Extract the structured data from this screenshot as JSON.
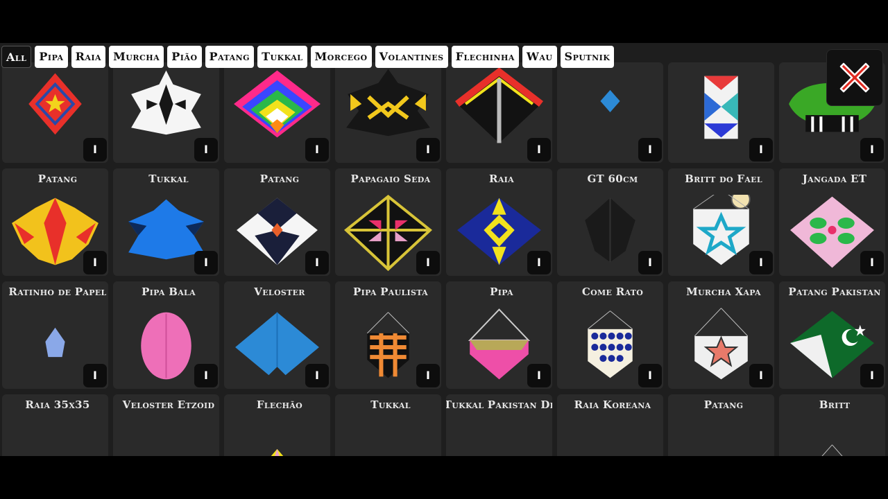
{
  "filters": [
    "All",
    "Pipa",
    "Raia",
    "Murcha",
    "Pião",
    "Patang",
    "Tukkal",
    "Morcego",
    "Volantines",
    "Flechinha",
    "Wau",
    "Sputnik"
  ],
  "active_filter": "All",
  "close_button_label": "",
  "info_label": "I",
  "kites": [
    {
      "name": "",
      "shape": "red-diamond-star"
    },
    {
      "name": "",
      "shape": "white-leaf"
    },
    {
      "name": "",
      "shape": "rainbow-chevron"
    },
    {
      "name": "",
      "shape": "black-leaf-yellow"
    },
    {
      "name": "",
      "shape": "red-black-diamond"
    },
    {
      "name": "",
      "shape": "small-blue"
    },
    {
      "name": "",
      "shape": "tall-triangles"
    },
    {
      "name": "",
      "shape": "green-blob"
    },
    {
      "name": "Patang",
      "shape": "red-yellow-leaf"
    },
    {
      "name": "Tukkal",
      "shape": "blue-leaf"
    },
    {
      "name": "Patang",
      "shape": "white-black-diamond"
    },
    {
      "name": "Papagaio Seda",
      "shape": "black-pink-diamond"
    },
    {
      "name": "Raia",
      "shape": "blue-yellow-star"
    },
    {
      "name": "GT 60cm",
      "shape": "black-kite"
    },
    {
      "name": "Britt do Fael",
      "shape": "white-teal-star"
    },
    {
      "name": "Jangada ET",
      "shape": "pink-green-diamond"
    },
    {
      "name": "Ratinho de Papel",
      "shape": "small-lightblue"
    },
    {
      "name": "Pipa Bala",
      "shape": "pink-oval"
    },
    {
      "name": "Veloster",
      "shape": "blue-veloster"
    },
    {
      "name": "Pipa Paulista",
      "shape": "orange-stripes"
    },
    {
      "name": "Pipa",
      "shape": "pink-olive"
    },
    {
      "name": "Come Rato",
      "shape": "dots"
    },
    {
      "name": "Murcha Xapa",
      "shape": "white-star"
    },
    {
      "name": "Patang Pakistan",
      "shape": "pakistan"
    },
    {
      "name": "Raia 35x35",
      "shape": "mask"
    },
    {
      "name": "Veloster Etzoid",
      "shape": "green-triangle"
    },
    {
      "name": "Flechão",
      "shape": "yellow-pink"
    },
    {
      "name": "Tukkal",
      "shape": "black-white"
    },
    {
      "name": "Tukkal Pakistan Dif",
      "shape": "dark-navy"
    },
    {
      "name": "Raia Koreana",
      "shape": "korean"
    },
    {
      "name": "Patang",
      "shape": "white-red-dots"
    },
    {
      "name": "Britt",
      "shape": "britt-pattern"
    }
  ]
}
